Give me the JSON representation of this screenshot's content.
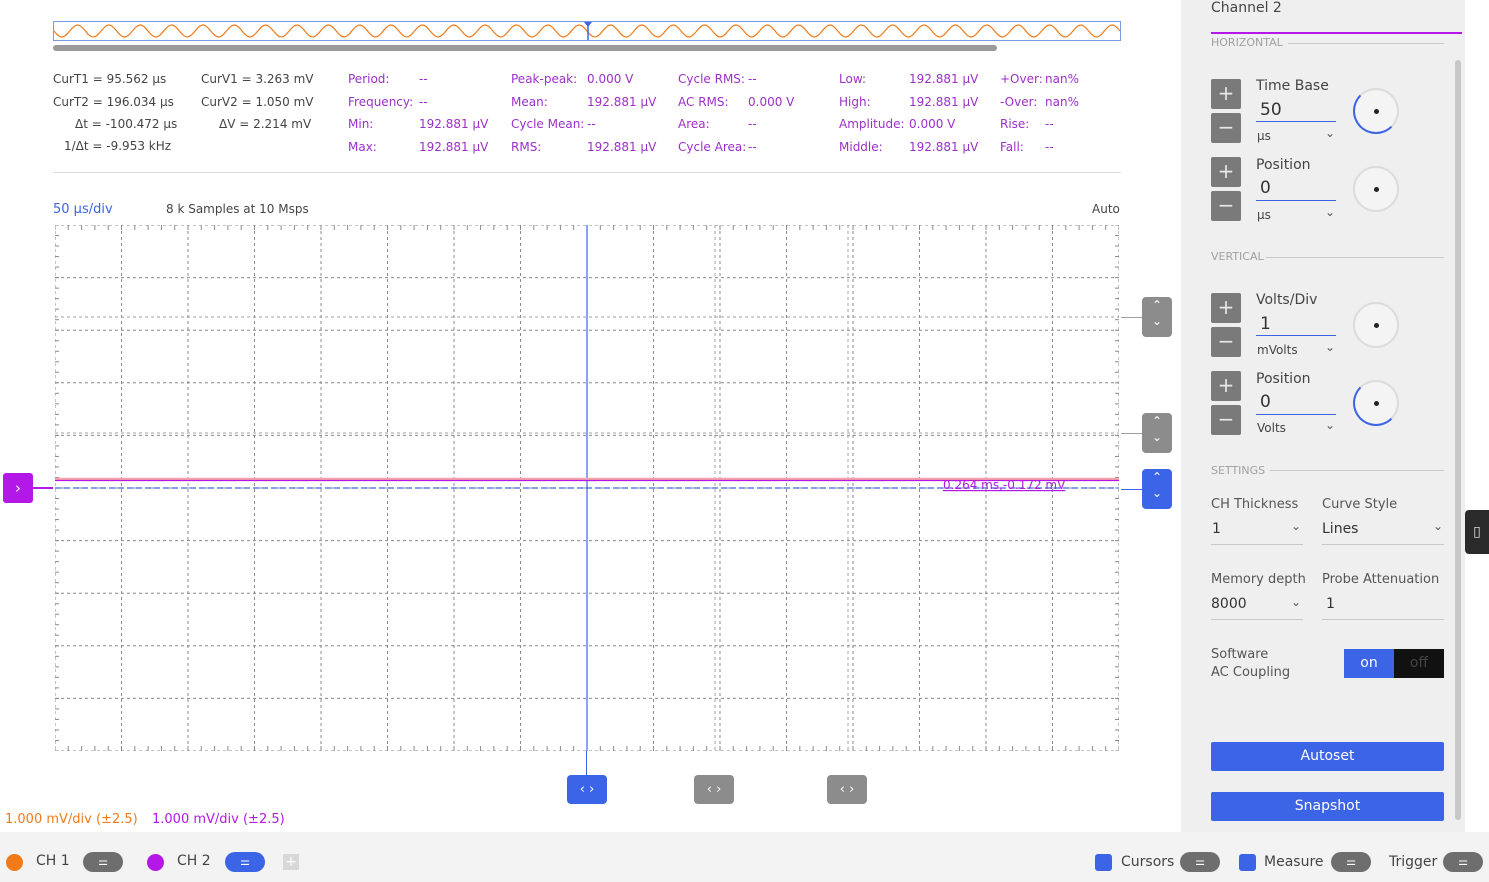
{
  "cursors": {
    "curT1": "CurT1 = 95.562 µs",
    "curT2": "CurT2 = 196.034 µs",
    "deltaT": "Δt = -100.472 µs",
    "invDeltaT": "1/Δt = -9.953 kHz",
    "curV1": "CurV1 = 3.263 mV",
    "curV2": "CurV2 = 1.050 mV",
    "deltaV": "ΔV = 2.214 mV"
  },
  "measurements": [
    {
      "label": "Period:",
      "value": "--"
    },
    {
      "label": "Frequency:",
      "value": "--"
    },
    {
      "label": "Min:",
      "value": "192.881 µV"
    },
    {
      "label": "Max:",
      "value": "192.881 µV"
    },
    {
      "label": "Peak-peak:",
      "value": "0.000 V"
    },
    {
      "label": "Mean:",
      "value": "192.881 µV"
    },
    {
      "label": "Cycle Mean:",
      "value": "--"
    },
    {
      "label": "RMS:",
      "value": "192.881 µV"
    },
    {
      "label": "Cycle RMS:",
      "value": "--"
    },
    {
      "label": "AC RMS:",
      "value": "0.000 V"
    },
    {
      "label": "Area:",
      "value": "--"
    },
    {
      "label": "Cycle Area:",
      "value": "--"
    },
    {
      "label": "Low:",
      "value": "192.881 µV"
    },
    {
      "label": "High:",
      "value": "192.881 µV"
    },
    {
      "label": "Amplitude:",
      "value": "0.000 V"
    },
    {
      "label": "Middle:",
      "value": "192.881 µV"
    },
    {
      "label": "+Over:",
      "value": "nan%"
    },
    {
      "label": "-Over:",
      "value": "nan%"
    },
    {
      "label": "Rise:",
      "value": "--"
    },
    {
      "label": "Fall:",
      "value": "--"
    }
  ],
  "plot": {
    "timebase": "50 µs/div",
    "samples": "8 k Samples at 10 Msps",
    "trigger_mode": "Auto",
    "cursor_readout": "0.264 ms,-0.172 mV",
    "ch1_scale": "1.000 mV/div (±2.5)",
    "ch2_scale": "1.000 mV/div (±2.5)"
  },
  "colors": {
    "ch1": "#f07b18",
    "ch2": "#b318e6",
    "accent": "#3c64e6"
  },
  "bottom": {
    "ch1": "CH 1",
    "ch2": "CH 2",
    "cursors": "Cursors",
    "measure": "Measure",
    "trigger": "Trigger"
  },
  "panel": {
    "title": "Channel 2",
    "horizontal": "HORIZONTAL",
    "time_base": {
      "label": "Time Base",
      "value": "50",
      "unit": "µs"
    },
    "h_position": {
      "label": "Position",
      "value": "0",
      "unit": "µs"
    },
    "vertical": "VERTICAL",
    "volts_div": {
      "label": "Volts/Div",
      "value": "1",
      "unit": "mVolts"
    },
    "v_position": {
      "label": "Position",
      "value": "0",
      "unit": "Volts"
    },
    "settings": "SETTINGS",
    "ch_thickness": {
      "label": "CH Thickness",
      "value": "1"
    },
    "curve_style": {
      "label": "Curve Style",
      "value": "Lines"
    },
    "memory_depth": {
      "label": "Memory depth",
      "value": "8000"
    },
    "probe_attenuation": {
      "label": "Probe Attenuation",
      "value": "1"
    },
    "ac_coupling_line1": "Software",
    "ac_coupling_line2": "AC Coupling",
    "toggle_on": "on",
    "toggle_off": "off",
    "autoset": "Autoset",
    "snapshot": "Snapshot"
  }
}
